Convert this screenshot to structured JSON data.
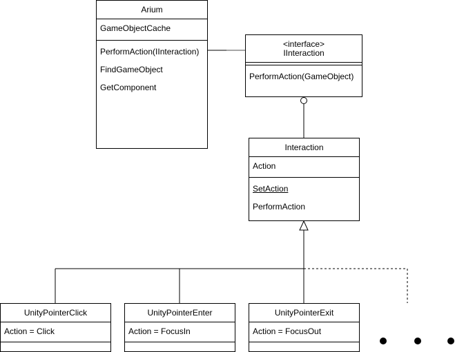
{
  "diagram": {
    "type": "uml-class-diagram",
    "classes": {
      "arium": {
        "name": "Arium",
        "attributes": [
          "GameObjectCache"
        ],
        "methods": [
          "PerformAction(IInteraction)",
          "FindGameObject",
          "GetComponent"
        ]
      },
      "iinteraction": {
        "stereotype": "<interface>",
        "name": "IInteraction",
        "attributes": [],
        "methods": [
          "PerformAction(GameObject)"
        ]
      },
      "interaction": {
        "name": "Interaction",
        "attributes": [
          "Action"
        ],
        "methods": [
          "SetAction",
          "PerformAction"
        ],
        "static_methods": [
          "SetAction"
        ]
      },
      "click": {
        "name": "UnityPointerClick",
        "attributes": [
          "Action = Click"
        ]
      },
      "enter": {
        "name": "UnityPointerEnter",
        "attributes": [
          "Action = FocusIn"
        ]
      },
      "exit": {
        "name": "UnityPointerExit",
        "attributes": [
          "Action = FocusOut"
        ]
      }
    },
    "relationships": [
      {
        "from": "Arium",
        "to": "IInteraction",
        "kind": "association"
      },
      {
        "from": "Interaction",
        "to": "IInteraction",
        "kind": "interface-realization (lollipop)"
      },
      {
        "from": "UnityPointerClick",
        "to": "Interaction",
        "kind": "generalization"
      },
      {
        "from": "UnityPointerEnter",
        "to": "Interaction",
        "kind": "generalization"
      },
      {
        "from": "UnityPointerExit",
        "to": "Interaction",
        "kind": "generalization"
      },
      {
        "from": "more (ellipsis)",
        "to": "Interaction",
        "kind": "generalization (dashed, omitted)"
      }
    ],
    "ellipsis": "• • •"
  }
}
